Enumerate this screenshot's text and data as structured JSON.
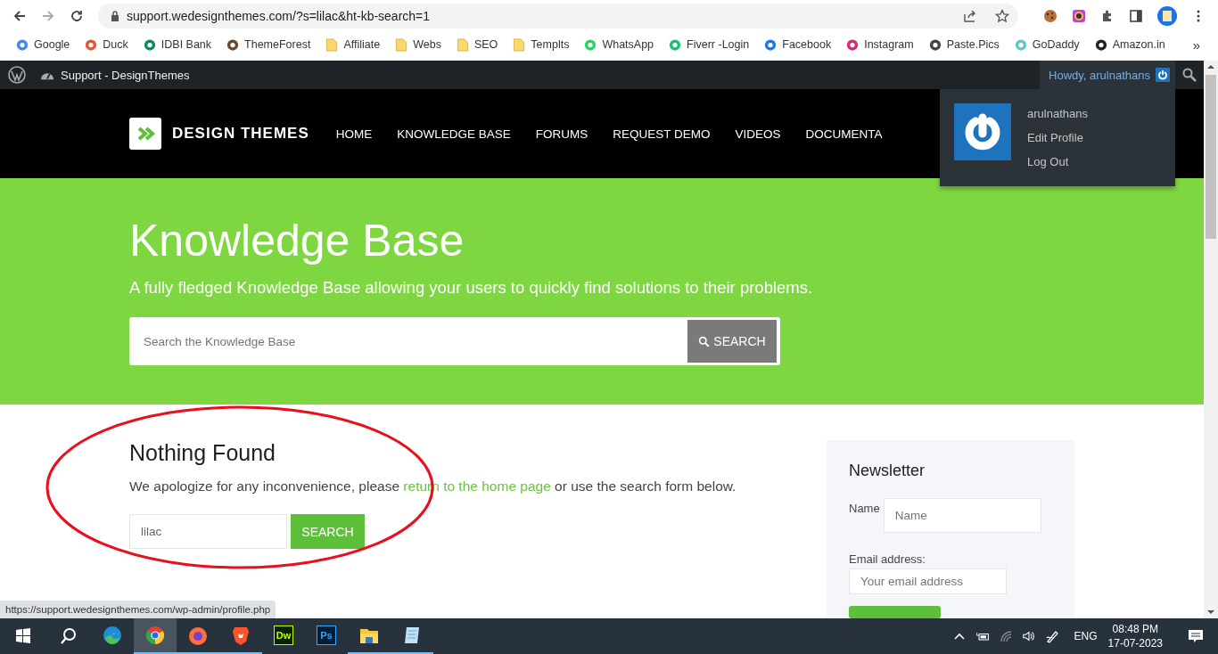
{
  "browser": {
    "url": "support.wedesignthemes.com/?s=lilac&ht-kb-search=1",
    "more": "»",
    "bookmarks": [
      {
        "kind": "google",
        "label": "Google"
      },
      {
        "kind": "duck",
        "label": "Duck"
      },
      {
        "kind": "bank",
        "label": "IDBI Bank"
      },
      {
        "kind": "themeforest",
        "label": "ThemeForest"
      },
      {
        "kind": "folder",
        "label": "Affiliate"
      },
      {
        "kind": "folder",
        "label": "Webs"
      },
      {
        "kind": "folder",
        "label": "SEO"
      },
      {
        "kind": "folder",
        "label": "Templts"
      },
      {
        "kind": "whatsapp",
        "label": "WhatsApp"
      },
      {
        "kind": "fiverr",
        "label": "Fiverr -Login"
      },
      {
        "kind": "facebook",
        "label": "Facebook"
      },
      {
        "kind": "instagram",
        "label": "Instagram"
      },
      {
        "kind": "paste",
        "label": "Paste.Pics"
      },
      {
        "kind": "godaddy",
        "label": "GoDaddy"
      },
      {
        "kind": "amazon",
        "label": "Amazon.in"
      }
    ]
  },
  "admin_bar": {
    "site": "Support - DesignThemes",
    "greeting": "Howdy, arulnathans"
  },
  "user_menu": {
    "username": "arulnathans",
    "items": [
      "Edit Profile",
      "Log Out"
    ]
  },
  "header": {
    "logo": "DESIGN THEMES",
    "nav": [
      "HOME",
      "KNOWLEDGE BASE",
      "FORUMS",
      "REQUEST DEMO",
      "VIDEOS",
      "DOCUMENTA"
    ]
  },
  "hero": {
    "title": "Knowledge Base",
    "subtitle": "A fully fledged Knowledge Base allowing your users to quickly find solutions to their problems.",
    "search": {
      "placeholder": "Search the Knowledge Base",
      "button": "SEARCH"
    }
  },
  "results": {
    "title": "Nothing Found",
    "message_before": "We apologize for any inconvenience, please ",
    "link": "return to the home page",
    "message_after": " or use the search form below.",
    "search": {
      "value": "lilac",
      "button": "SEARCH"
    }
  },
  "newsletter": {
    "title": "Newsletter",
    "name_label": "Name",
    "name_placeholder": "Name",
    "email_label": "Email address:",
    "email_placeholder": "Your email address"
  },
  "status_url": "https://support.wedesignthemes.com/wp-admin/profile.php",
  "taskbar": {
    "apps": [
      {
        "kind": "edge",
        "selected": false,
        "running": false
      },
      {
        "kind": "chrome",
        "selected": true,
        "running": true
      },
      {
        "kind": "firefox",
        "selected": false,
        "running": true
      },
      {
        "kind": "brave",
        "selected": false,
        "running": true
      },
      {
        "kind": "dw",
        "label": "Dw",
        "selected": false,
        "running": false
      },
      {
        "kind": "ps",
        "label": "Ps",
        "selected": false,
        "running": false
      },
      {
        "kind": "explorer",
        "selected": false,
        "running": true
      },
      {
        "kind": "notepad",
        "selected": false,
        "running": true
      }
    ],
    "language": "ENG",
    "time": "08:48 PM",
    "date": "17-07-2023"
  }
}
